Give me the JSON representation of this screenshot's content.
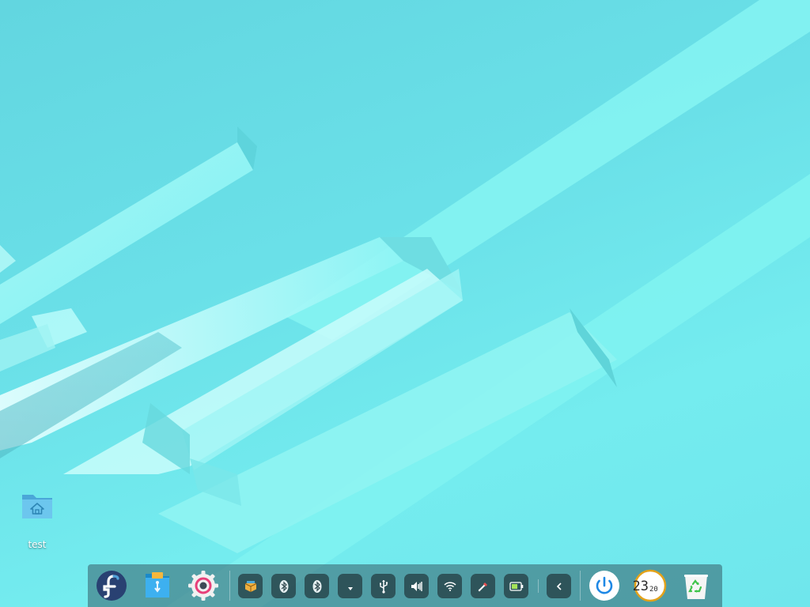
{
  "desktop": {
    "icons": [
      {
        "label": "test"
      }
    ]
  },
  "dock": {
    "apps": [
      {
        "icon": "fedora-launcher-icon"
      },
      {
        "icon": "file-manager-icon"
      },
      {
        "icon": "settings-gear-icon"
      }
    ],
    "tray": [
      {
        "icon": "package-icon"
      },
      {
        "icon": "bluetooth-icon"
      },
      {
        "icon": "bluetooth-icon"
      },
      {
        "icon": "network-down-icon"
      },
      {
        "icon": "usb-icon"
      },
      {
        "icon": "volume-icon"
      },
      {
        "icon": "wifi-icon"
      },
      {
        "icon": "screen-picker-icon"
      },
      {
        "icon": "battery-icon"
      },
      {
        "icon": "chevron-left-icon"
      }
    ],
    "clock": {
      "hours": "23",
      "minutes": "20"
    },
    "colors": {
      "power_blue": "#1e88e5",
      "clock_ring": "#e3a21a",
      "recycle_green": "#3fc44b"
    }
  }
}
